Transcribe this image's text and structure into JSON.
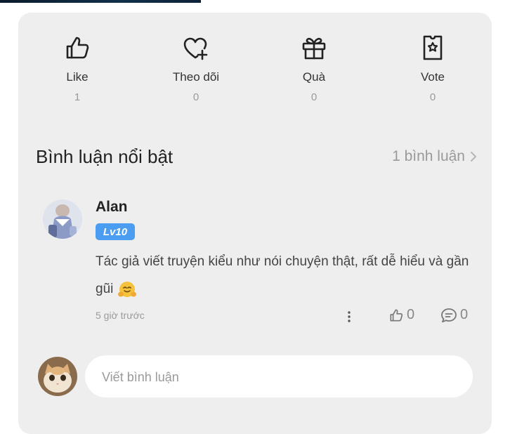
{
  "stats": [
    {
      "icon": "thumbs-up-icon",
      "label": "Like",
      "count": "1"
    },
    {
      "icon": "heart-plus-icon",
      "label": "Theo dõi",
      "count": "0"
    },
    {
      "icon": "gift-icon",
      "label": "Quà",
      "count": "0"
    },
    {
      "icon": "vote-ticket-icon",
      "label": "Vote",
      "count": "0"
    }
  ],
  "comments_section": {
    "title": "Bình luận nổi bật",
    "count_label": "1 bình luận"
  },
  "comment": {
    "author": "Alan",
    "level": "Lv10",
    "text": "Tác giả viết truyện kiểu như nói chuyện thật, rất dễ hiểu và gần gũi",
    "emoji": "hugging-face-emoji",
    "time": "5 giờ trước",
    "like_count": "0",
    "reply_count": "0"
  },
  "composer": {
    "placeholder": "Viết bình luận"
  },
  "colors": {
    "card_bg": "#eeeeee",
    "level_badge": "#4a9df0",
    "muted_text": "#9a9a9a"
  }
}
